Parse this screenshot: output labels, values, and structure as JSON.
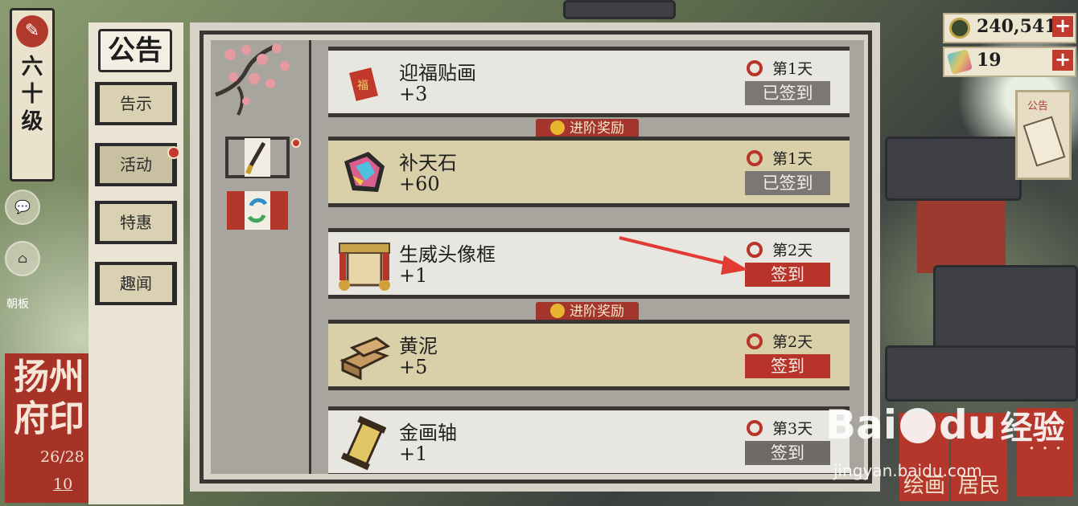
{
  "rank": {
    "level_text": "六\n十\n级"
  },
  "side": {
    "left_label": "朝板"
  },
  "city_seal": {
    "title": "扬州府印",
    "count": "26/28",
    "level": "10"
  },
  "nav": {
    "title": "公告",
    "tabs": [
      {
        "label": "告示"
      },
      {
        "label": "活动",
        "badge": true
      },
      {
        "label": "特惠"
      },
      {
        "label": "趣闻"
      }
    ]
  },
  "currency": [
    {
      "icon": "coin-icon",
      "value": "240,541"
    },
    {
      "icon": "jade-ticket-icon",
      "value": "19"
    }
  ],
  "notice_card": {
    "label": "公告"
  },
  "banner_label": "进阶奖励",
  "rewards": [
    {
      "name": "迎福贴画",
      "qty": "+3",
      "icon": "fortune-poster-icon",
      "day": "第1天",
      "status": "已签到",
      "state": "done",
      "advanced": false
    },
    {
      "name": "补天石",
      "qty": "+60",
      "icon": "sky-stone-icon",
      "day": "第1天",
      "status": "已签到",
      "state": "done",
      "advanced": true
    },
    {
      "name": "生威头像框",
      "qty": "+1",
      "icon": "avatar-frame-icon",
      "day": "第2天",
      "status": "签到",
      "state": "sign",
      "advanced": false
    },
    {
      "name": "黄泥",
      "qty": "+5",
      "icon": "yellow-clay-icon",
      "day": "第2天",
      "status": "签到",
      "state": "sign",
      "advanced": true
    },
    {
      "name": "金画轴",
      "qty": "+1",
      "icon": "golden-scroll-icon",
      "day": "第3天",
      "status": "签到",
      "state": "locked",
      "advanced": false
    }
  ],
  "bottom_buttons": [
    {
      "label": "绘画"
    },
    {
      "label": "居民"
    }
  ],
  "watermark": {
    "brand": "Bai",
    "brand2": "du",
    "cn": "经验",
    "url": "jingyan.baidu.com"
  },
  "colors": {
    "accent_red": "#b8342a",
    "done_grey": "#7a7774",
    "paper": "#e8e6e1",
    "advanced_bg": "#d9cfa9"
  }
}
